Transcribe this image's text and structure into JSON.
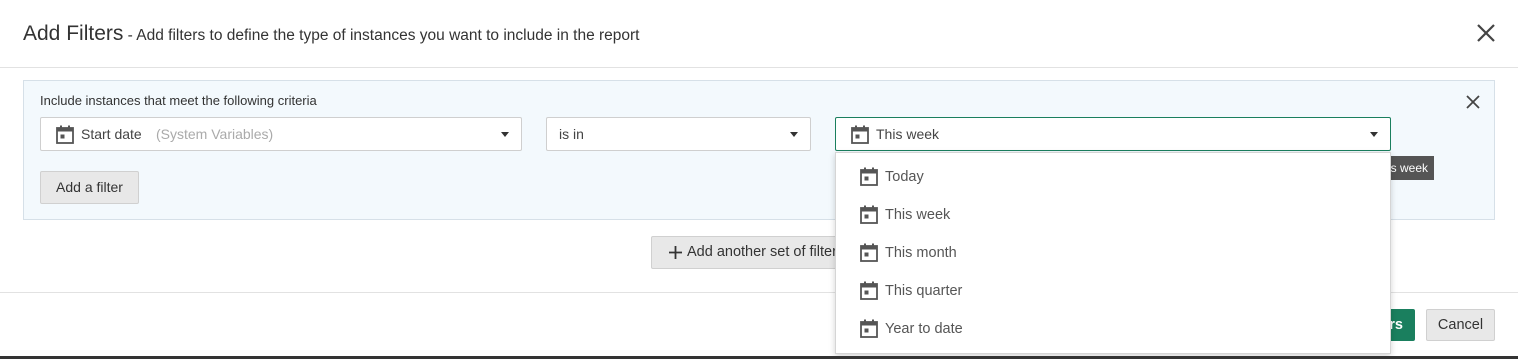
{
  "dialog": {
    "title": "Add Filters",
    "subtitle": " - Add filters to define the type of instances you want to include in the report",
    "close_icon": "close-icon"
  },
  "criteria_panel": {
    "heading": "Include instances that meet the following criteria",
    "field_select": {
      "icon": "calendar-icon",
      "value": "Start date",
      "hint": "(System Variables)"
    },
    "operator_select": {
      "value": "is in"
    },
    "value_select": {
      "icon": "calendar-icon",
      "value": "This week"
    },
    "add_filter_label": "Add a filter"
  },
  "add_another_set_label": "Add another set of filters",
  "footer": {
    "apply_label": "Apply filters",
    "cancel_label": "Cancel",
    "accent_color": "#1a7f5e"
  },
  "tooltip": "This week",
  "dropdown": {
    "options": [
      {
        "label": "Today",
        "icon": "calendar-icon"
      },
      {
        "label": "This week",
        "icon": "calendar-icon"
      },
      {
        "label": "This month",
        "icon": "calendar-icon"
      },
      {
        "label": "This quarter",
        "icon": "calendar-icon"
      },
      {
        "label": "Year to date",
        "icon": "calendar-icon"
      }
    ]
  }
}
